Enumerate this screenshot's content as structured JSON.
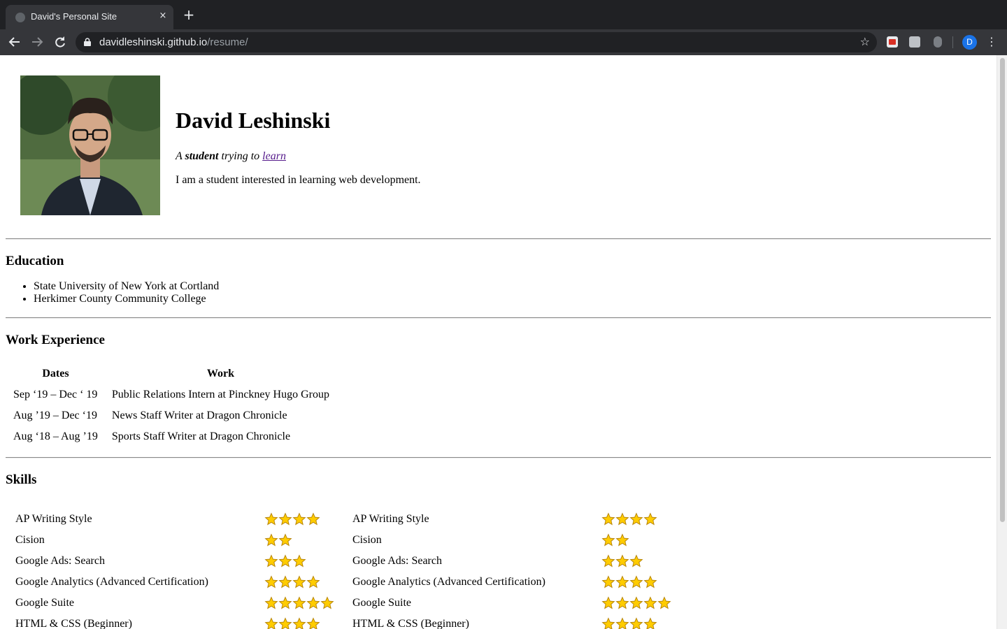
{
  "browser": {
    "tab_title": "David's Personal Site",
    "tab_close": "×",
    "new_tab": "+",
    "url_host": "davidleshinski.github.io",
    "url_path": "/resume/",
    "avatar_letter": "D"
  },
  "header": {
    "name": "David Leshinski",
    "tagline_prefix": "A ",
    "tagline_strong": "student",
    "tagline_middle": " trying to ",
    "tagline_link": "learn",
    "intro": "I am a student interested in learning web development."
  },
  "education": {
    "heading": "Education",
    "items": [
      "State University of New York at Cortland",
      "Herkimer County Community College"
    ]
  },
  "work": {
    "heading": "Work Experience",
    "columns": [
      "Dates",
      "Work"
    ],
    "rows": [
      {
        "dates": "Sep ‘19 – Dec ‘ 19",
        "work": "Public Relations Intern at Pinckney Hugo Group"
      },
      {
        "dates": "Aug ’19 – Dec ‘19",
        "work": "News Staff Writer at Dragon Chronicle"
      },
      {
        "dates": "Aug ‘18 – Aug ’19",
        "work": "Sports Staff Writer at Dragon Chronicle"
      }
    ]
  },
  "skills": {
    "heading": "Skills",
    "rows": [
      {
        "left": {
          "name": "AP Writing Style",
          "stars": 4
        },
        "right": {
          "name": "AP Writing Style",
          "stars": 4
        }
      },
      {
        "left": {
          "name": "Cision",
          "stars": 2
        },
        "right": {
          "name": "Cision",
          "stars": 2
        }
      },
      {
        "left": {
          "name": "Google Ads: Search",
          "stars": 3
        },
        "right": {
          "name": "Google Ads: Search",
          "stars": 3
        }
      },
      {
        "left": {
          "name": "Google Analytics (Advanced Certification)",
          "stars": 4
        },
        "right": {
          "name": "Google Analytics (Advanced Certification)",
          "stars": 4
        }
      },
      {
        "left": {
          "name": "Google Suite",
          "stars": 5
        },
        "right": {
          "name": "Google Suite",
          "stars": 5
        }
      },
      {
        "left": {
          "name": "HTML & CSS (Beginner)",
          "stars": 4
        },
        "right": {
          "name": "HTML & CSS (Beginner)",
          "stars": 4
        }
      }
    ]
  },
  "colors": {
    "link_visited": "#551a8b",
    "star_fill": "#ffcc00",
    "star_stroke": "#b8860b"
  },
  "icons": {
    "back": "arrow-left-icon",
    "forward": "arrow-right-icon",
    "reload": "reload-icon",
    "lock": "lock-icon",
    "bookmark": "star-outline-icon",
    "menu": "kebab-menu-icon"
  }
}
